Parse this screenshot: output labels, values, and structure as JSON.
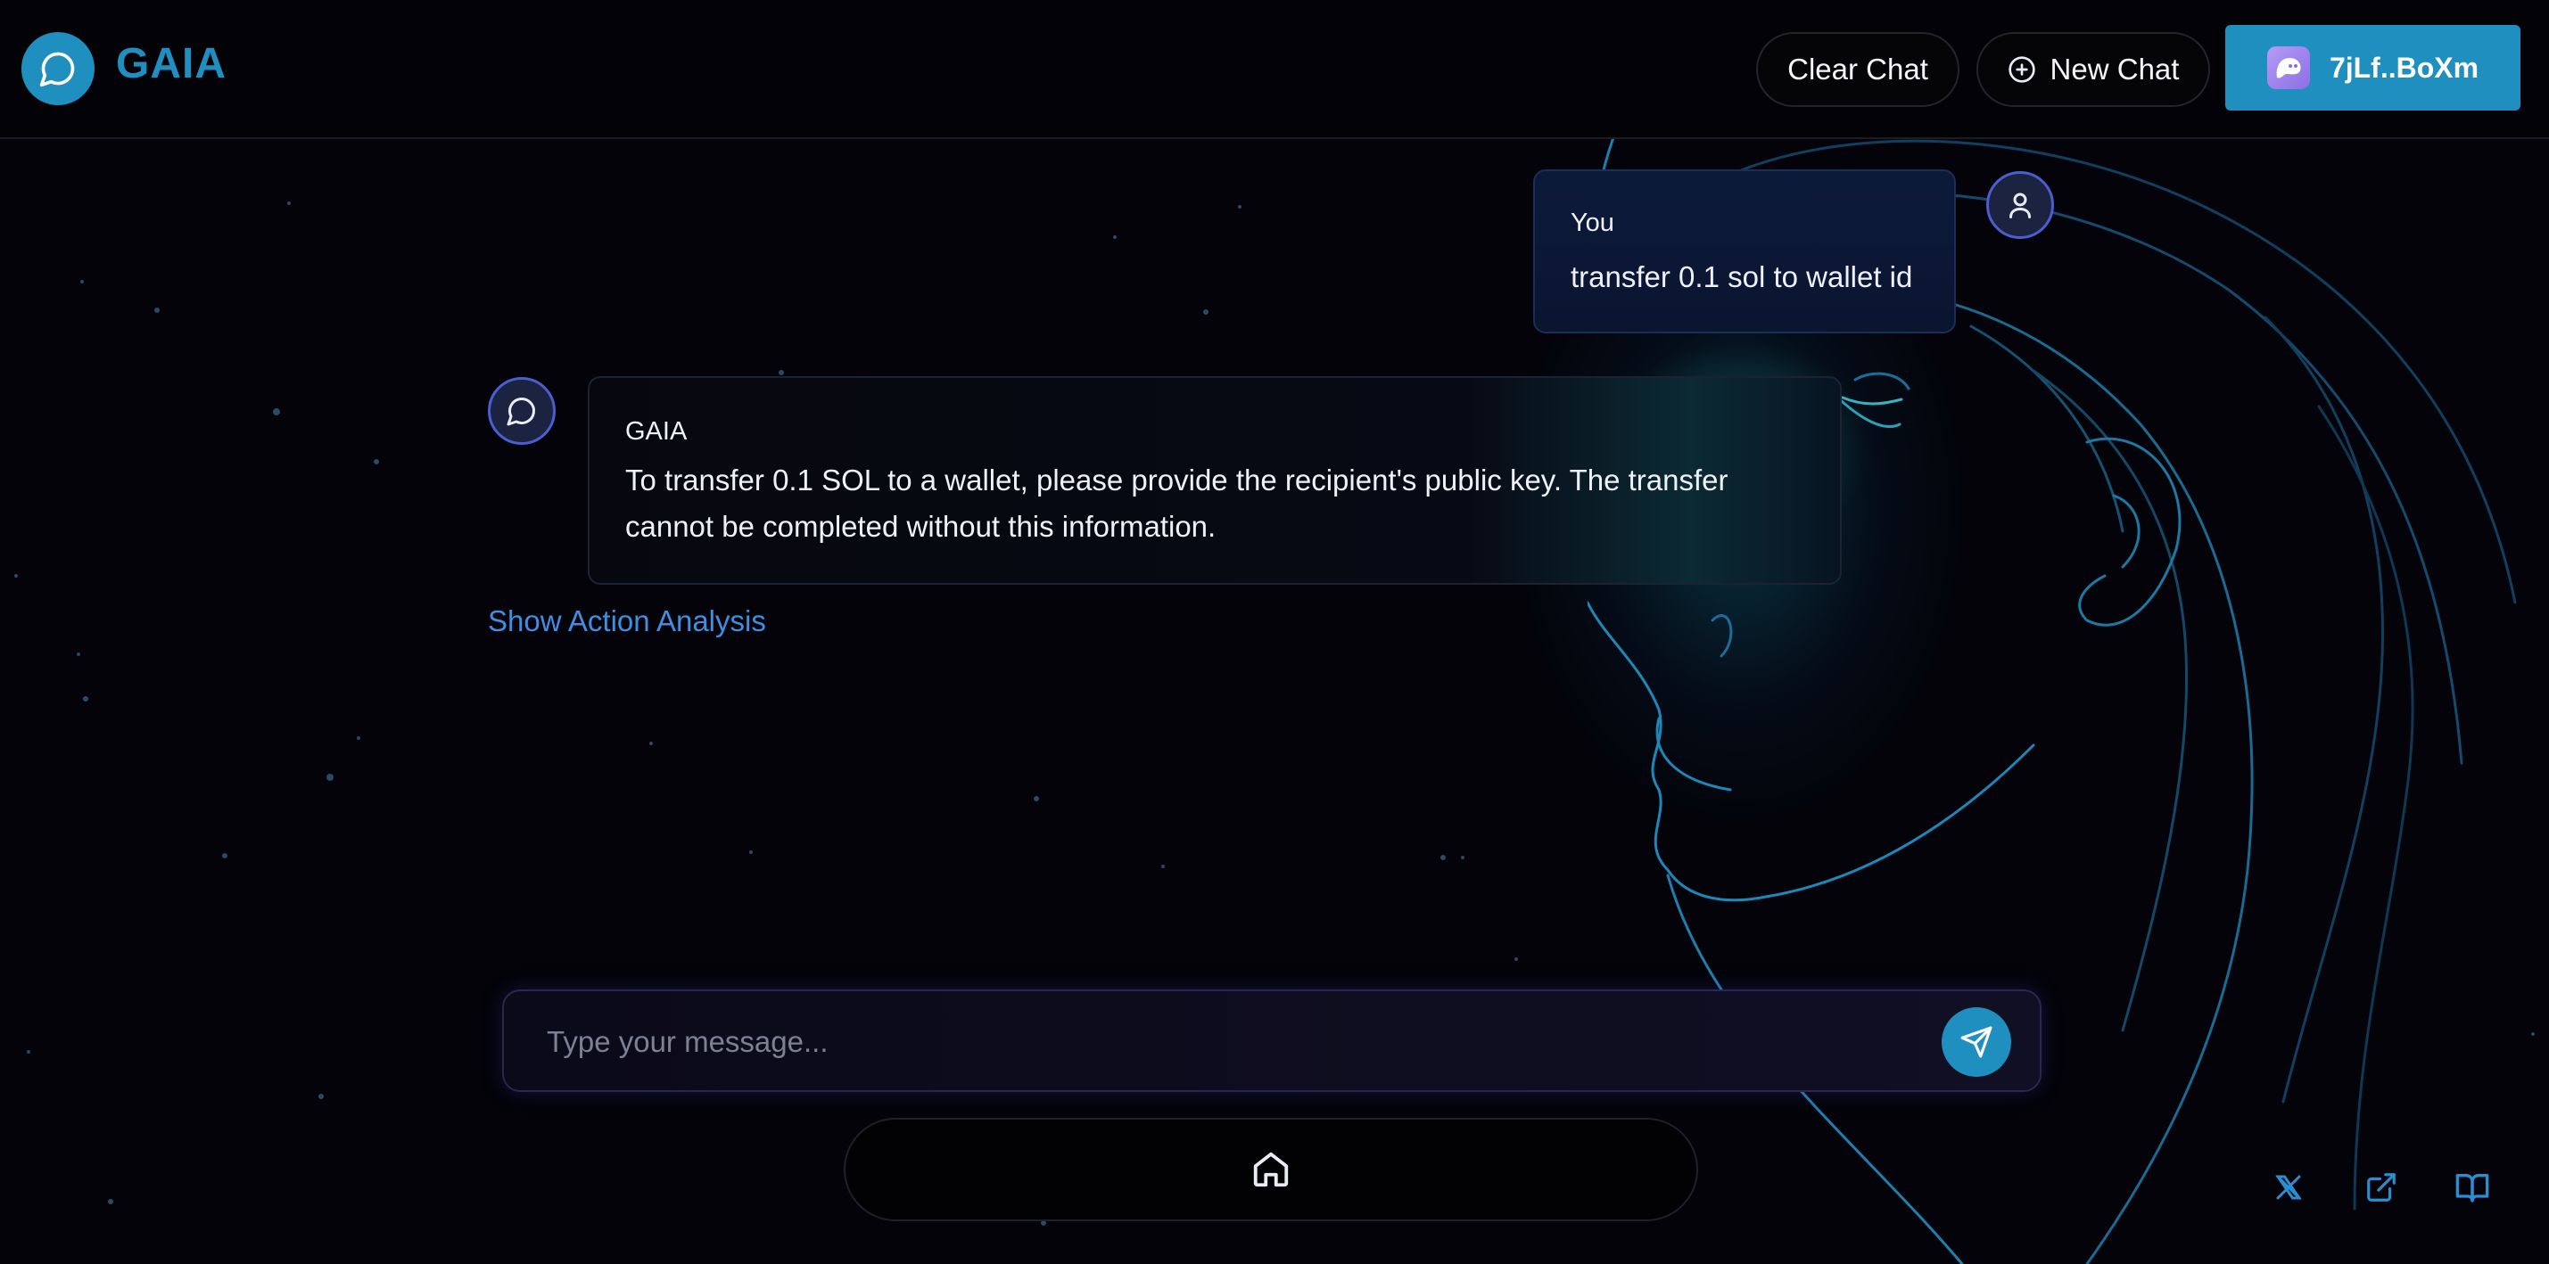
{
  "header": {
    "app_name": "GAIA",
    "clear_chat_label": "Clear Chat",
    "new_chat_label": "New Chat",
    "wallet_label": "7jLf..BoXm",
    "brand_color": "#1f8fc0"
  },
  "messages": [
    {
      "sender": "You",
      "text": "transfer 0.1 sol to wallet id"
    },
    {
      "sender": "GAIA",
      "text": "To transfer 0.1 SOL to a wallet, please provide the recipient's public key. The transfer cannot be completed without this information."
    }
  ],
  "action_analysis_label": "Show Action Analysis",
  "composer": {
    "placeholder": "Type your message..."
  },
  "icons": {
    "logo": "chat-bubble-icon",
    "new_chat": "plus-circle-icon",
    "wallet": "phantom-ghost-icon",
    "user_avatar": "user-icon",
    "bot_avatar": "chat-bubble-icon",
    "send": "send-icon",
    "home": "home-icon",
    "footer": [
      "x-logo-icon",
      "external-link-icon",
      "book-icon"
    ]
  }
}
